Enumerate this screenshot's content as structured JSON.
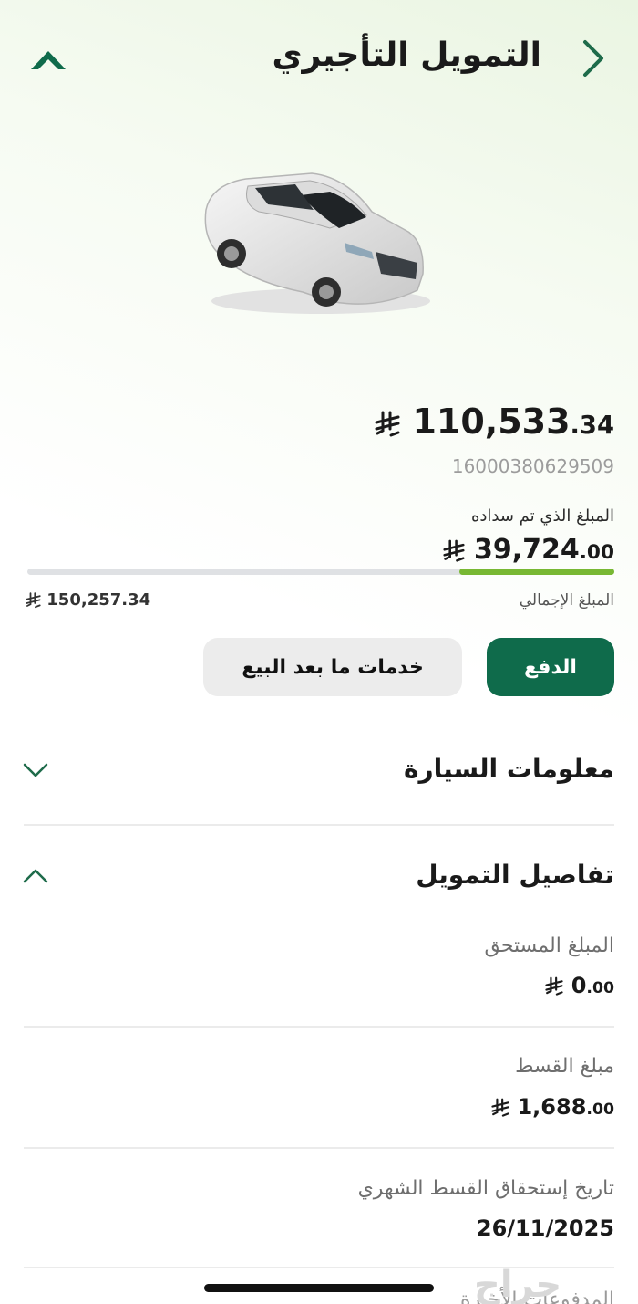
{
  "header": {
    "title": "التمويل التأجيري"
  },
  "car": {
    "remaining_amount_int": "110,533",
    "remaining_amount_dec": ".34",
    "contract_number": "16000380629509"
  },
  "payment": {
    "paid_label": "المبلغ الذي تم سداده",
    "paid_amount_int": "39,724",
    "paid_amount_dec": ".00",
    "progress_fraction": 0.264,
    "total_label": "المبلغ الإجمالي",
    "total_amount": "150,257.34"
  },
  "actions": {
    "pay_label": "الدفع",
    "after_sales_label": "خدمات ما بعد البيع"
  },
  "sections": {
    "car_info_title": "معلومات السيارة",
    "finance_details_title": "تفاصيل التمويل"
  },
  "finance_details": {
    "due_label": "المبلغ المستحق",
    "due_int": "0",
    "due_dec": ".00",
    "installment_label": "مبلغ القسط",
    "installment_int": "1,688",
    "installment_dec": ".00",
    "due_date_label": "تاريخ إستحقاق القسط الشهري",
    "due_date_value": "26/11/2025",
    "next_label_partial": "المدفوعات الأخيرة"
  },
  "watermark": {
    "text": "حراج"
  },
  "colors": {
    "brand_green": "#0f6b4b",
    "progress_green": "#78b833",
    "accent_chevron": "#1e6b4a"
  },
  "icons": {
    "back": "chevron-right-icon",
    "home": "home-chevron-icon",
    "riyal": "saudi-riyal-icon",
    "collapse": "chevron-down-icon",
    "expand": "chevron-up-icon"
  }
}
